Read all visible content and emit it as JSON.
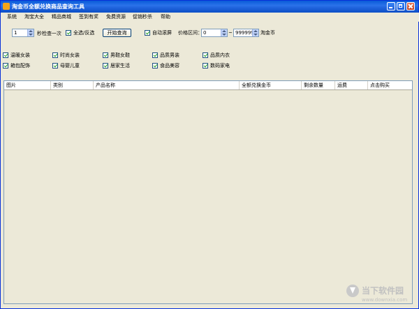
{
  "window": {
    "title": "淘金币全额兑换商品查询工具"
  },
  "menu": [
    "系统",
    "淘宝大全",
    "精品商城",
    "签到有奖",
    "免费资源",
    "促销秒杀",
    "帮助"
  ],
  "toolbar": {
    "interval_value": "1",
    "interval_label": "秒检查一次",
    "select_all_label": "全选/反选",
    "start_button": "开始查询",
    "auto_scroll_label": "自动滚屏",
    "price_label": "价格区间：",
    "price_min": "0",
    "price_dash": "~",
    "price_max": "999999",
    "price_unit": "淘金币"
  },
  "categories": [
    "温暖女装",
    "时尚女装",
    "男鞋女鞋",
    "品质男装",
    "品质内衣",
    "箱包配饰",
    "母婴儿童",
    "居家生活",
    "食品美容",
    "数码家电"
  ],
  "table": {
    "columns": [
      "图片",
      "类别",
      "产品名称",
      "全额兑换金币",
      "剩余数量",
      "运费",
      "点击购买"
    ]
  },
  "watermark": {
    "text": "当下软件园",
    "url": "www.downxia.com"
  }
}
